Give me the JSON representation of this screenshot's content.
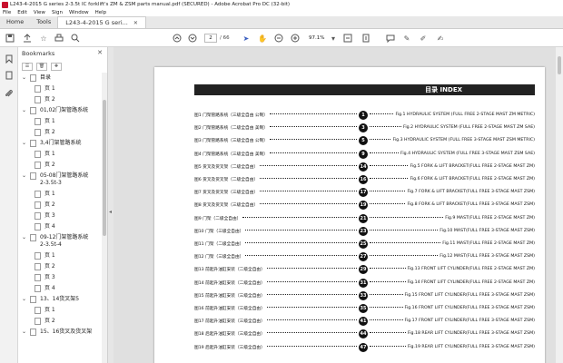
{
  "window": {
    "title": "L243-4-2015 G series 2-3.5t IC forklift's ZM & ZSM parts manual.pdf (SECURED) - Adobe Acrobat Pro DC (32-bit)"
  },
  "menu": [
    "File",
    "Edit",
    "View",
    "Sign",
    "Window",
    "Help"
  ],
  "tabs": {
    "home": "Home",
    "tools": "Tools",
    "document": "L243-4-2015 G seri..."
  },
  "toolbar": {
    "page_current": "2",
    "page_total": "/ 66",
    "zoom": "97.1%"
  },
  "bookmarks": {
    "title": "Bookmarks",
    "items": [
      {
        "label": "目录",
        "level": 0,
        "expanded": true
      },
      {
        "label": "页 1",
        "level": 1
      },
      {
        "label": "页 2",
        "level": 1
      },
      {
        "label": "01,02门架管路系统",
        "level": 0,
        "expanded": true
      },
      {
        "label": "页 1",
        "level": 1
      },
      {
        "label": "页 2",
        "level": 1
      },
      {
        "label": "3,4门架管路系统",
        "level": 0,
        "expanded": true
      },
      {
        "label": "页 1",
        "level": 1
      },
      {
        "label": "页 2",
        "level": 1
      },
      {
        "label": "05-08门架管路系统",
        "level": 0,
        "expanded": true
      },
      {
        "label": "2-3.5t-3",
        "level": 0,
        "cont": true
      },
      {
        "label": "页 1",
        "level": 1
      },
      {
        "label": "页 2",
        "level": 1
      },
      {
        "label": "页 3",
        "level": 1
      },
      {
        "label": "页 4",
        "level": 1
      },
      {
        "label": "09-12门架管路系统",
        "level": 0,
        "expanded": true
      },
      {
        "label": "2-3.5t-4",
        "level": 0,
        "cont": true
      },
      {
        "label": "页 1",
        "level": 1
      },
      {
        "label": "页 2",
        "level": 1
      },
      {
        "label": "页 3",
        "level": 1
      },
      {
        "label": "页 4",
        "level": 1
      },
      {
        "label": "13、14货叉架5",
        "level": 0,
        "expanded": true
      },
      {
        "label": "页 1",
        "level": 1
      },
      {
        "label": "页 2",
        "level": 1
      },
      {
        "label": "15、16货叉及货叉架",
        "level": 0,
        "expanded": true
      }
    ]
  },
  "document": {
    "index_title": "目录 INDEX",
    "entries": [
      {
        "left": "图1 门架管路系统（三级全自由  公制）",
        "num": "1",
        "right": "Fig.1 HYDRAULIC SYSTEM  (FULL FREE 2-STAGE MAST ZM METRIC)"
      },
      {
        "left": "图2 门架管路系统（二级全自由  美制）",
        "num": "3",
        "right": "Fig.2 HYDRAULIC SYSTEM  (FULL FREE 2-STAGE MAST ZM SAE)"
      },
      {
        "left": "图3 门架管路系统（三级全自由  公制）",
        "num": "5",
        "right": "Fig.3 HYDRAULIC SYSTEM  (FULL FREE 3-STAGE MAST ZSM METRIC)"
      },
      {
        "left": "图4 门架管路系统（三级全自由  美制）",
        "num": "9",
        "right": "Fig.4 HYDRAULIC SYSTEM  (FULL FREE 3-STAGE MAST ZSM SAE)"
      },
      {
        "left": "图5 货叉及货叉架（二级全自由）",
        "num": "14",
        "right": "Fig.5 FORK & LIFT BRACKET(FULL FREE 2-STAGE MAST ZM)"
      },
      {
        "left": "图6 货叉及货叉架（二级全自由）",
        "num": "16",
        "right": "Fig.6 FORK & LIFT BRACKET(FULL FREE 2-STAGE MAST ZM)"
      },
      {
        "left": "图7 货叉及货叉架（三级全自由）",
        "num": "17",
        "right": "Fig.7 FORK & LIFT BRACKET(FULL FREE 3-STAGE MAST ZSM)"
      },
      {
        "left": "图8 货叉及货叉架（三级全自由）",
        "num": "19",
        "right": "Fig.8 FORK & LIFT BRACKET(FULL FREE 3-STAGE MAST ZSM)"
      },
      {
        "left": "图9 门架（二级全自由）",
        "num": "21",
        "right": "Fig.9 MAST(FULL FREE 2-STAGE MAST ZM)"
      },
      {
        "left": "图10 门架（三级全自由）",
        "num": "23",
        "right": "Fig.10 MAST(FULL FREE 3-STAGE MAST ZSM)"
      },
      {
        "left": "图11 门架（二级全自由）",
        "num": "25",
        "right": "Fig.11 MAST(FULL FREE 2-STAGE MAST ZM)"
      },
      {
        "left": "图12 门架（三级全自由）",
        "num": "27",
        "right": "Fig.12 MAST(FULL FREE 3-STAGE MAST ZSM)"
      },
      {
        "left": "图13 前起升油缸安装（二级全自由）",
        "num": "29",
        "right": "Fig.13 FRONT LIFT CYLINDER(FULL FREE 2-STAGE MAST ZM)"
      },
      {
        "left": "图14 前起升油缸安装（二级全自由）",
        "num": "31",
        "right": "Fig.14 FRONT LIFT CYLINDER(FULL FREE 2-STAGE MAST ZM)"
      },
      {
        "left": "图15 前起升油缸安装（三级全自由）",
        "num": "33",
        "right": "Fig.15 FRONT LIFT CYLINDER(FULL FREE 3-STAGE MAST ZSM)"
      },
      {
        "left": "图16 前起升油缸安装（三级全自由）",
        "num": "35",
        "right": "Fig.16 FRONT LIFT CYLINDER(FULL FREE 3-STAGE MAST ZSM)"
      },
      {
        "left": "图17 前起升油缸安装（三级全自由）",
        "num": "41",
        "right": "Fig.17 FRONT LIFT CYLINDER(FULL FREE 3-STAGE MAST ZSM)"
      },
      {
        "left": "图18 后起升油缸安装（三级全自由）",
        "num": "44",
        "right": "Fig.18 REAR LIFT CYLINDER(FULL FREE 3-STAGE MAST ZSM)"
      },
      {
        "left": "图19 后起升油缸安装（三级全自由）",
        "num": "47",
        "right": "Fig.19 REAR LIFT CYLINDER(FULL FREE 3-STAGE MAST ZSM)"
      }
    ]
  }
}
